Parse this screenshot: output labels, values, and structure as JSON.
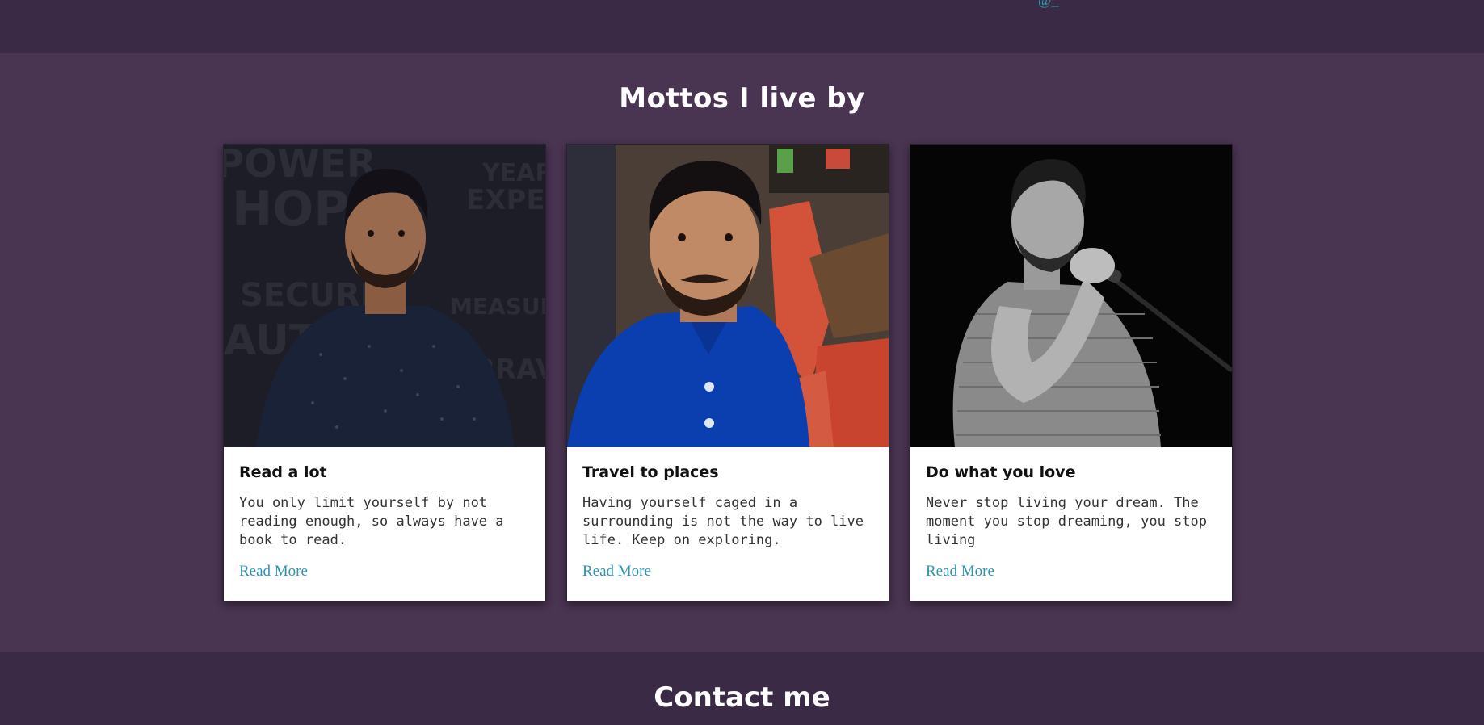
{
  "header": {
    "partial_link": "@_"
  },
  "mottos": {
    "title": "Mottos I live by",
    "cards": [
      {
        "title": "Read a lot",
        "text": "You only limit yourself by not reading enough, so always have a book to read.",
        "link": "Read More",
        "image": "man-dark-shirt-photo"
      },
      {
        "title": "Travel to places",
        "text": "Having yourself caged in a surrounding is not the way to live life. Keep on exploring.",
        "link": "Read More",
        "image": "man-blue-polo-selfie-photo"
      },
      {
        "title": "Do what you love",
        "text": "Never stop living your dream. The moment you stop dreaming, you stop living",
        "link": "Read More",
        "image": "man-singing-microphone-photo"
      }
    ]
  },
  "contact": {
    "title": "Contact me"
  },
  "colors": {
    "page_bg": "#3b2a45",
    "section_bg": "#493451",
    "link": "#2a93b5"
  }
}
